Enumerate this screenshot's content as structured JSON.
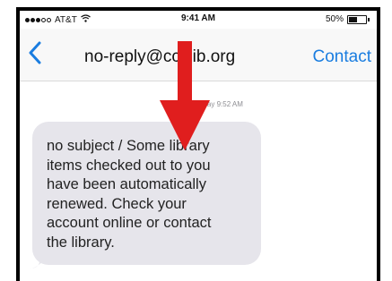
{
  "status_bar": {
    "carrier": "AT&T",
    "time": "9:41 AM",
    "battery_percent": "50%",
    "battery_level": 0.5,
    "wifi_icon": "wifi-icon",
    "signal_bars_filled": 3,
    "signal_bars_total": 5
  },
  "nav": {
    "back_icon": "chevron-left-icon",
    "title": "no-reply@ccslib.org",
    "contact_label": "Contact",
    "accent_color": "#1a7de0"
  },
  "conversation": {
    "timestamp": "Today 9:52 AM",
    "message": "no subject / Some library\nitems checked out to you\nhave been automatically\nrenewed. Check your\naccount online or contact\nthe library.",
    "bubble_color": "#e6e5eb"
  },
  "annotation": {
    "arrow_icon": "down-arrow-icon",
    "arrow_color": "#e01e1e"
  }
}
